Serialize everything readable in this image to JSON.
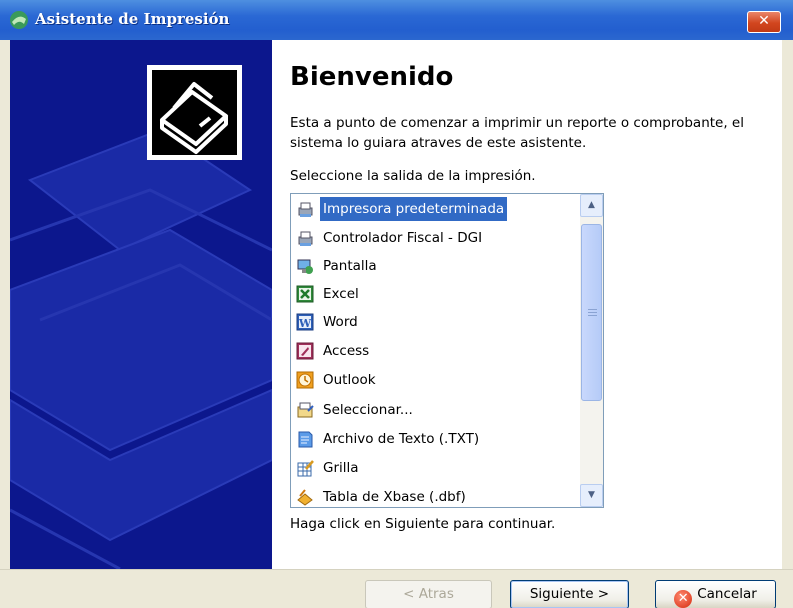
{
  "window": {
    "title": "Asistente de Impresión",
    "close_glyph": "✕"
  },
  "main": {
    "heading": "Bienvenido",
    "description": "Esta a punto de comenzar a imprimir un reporte o comprobante, el sistema lo guiara atraves de este asistente.",
    "prompt": "Seleccione la salida de la impresión.",
    "hint": "Haga click en Siguiente para continuar.",
    "selected_index": 0,
    "items": [
      {
        "label": "Impresora predeterminada",
        "icon": "printer-icon"
      },
      {
        "label": "Controlador Fiscal - DGI",
        "icon": "printer-icon"
      },
      {
        "label": "Pantalla",
        "icon": "screen-icon"
      },
      {
        "label": "Excel",
        "icon": "excel-icon"
      },
      {
        "label": "Word",
        "icon": "word-icon"
      },
      {
        "label": "Access",
        "icon": "access-icon"
      },
      {
        "label": "Outlook",
        "icon": "outlook-icon"
      },
      {
        "label": "Seleccionar...",
        "icon": "select-icon"
      },
      {
        "label": "Archivo de Texto (.TXT)",
        "icon": "text-file-icon"
      },
      {
        "label": "Grilla",
        "icon": "grid-icon"
      },
      {
        "label": "Tabla de Xbase (.dbf)",
        "icon": "dbf-icon"
      }
    ]
  },
  "buttons": {
    "back_label": "< Atras",
    "next_label": "Siguiente >",
    "cancel_label": "Cancelar"
  },
  "colors": {
    "titlebar": "#235fcf",
    "side_panel": "#0c178d",
    "selection": "#316ac5"
  }
}
